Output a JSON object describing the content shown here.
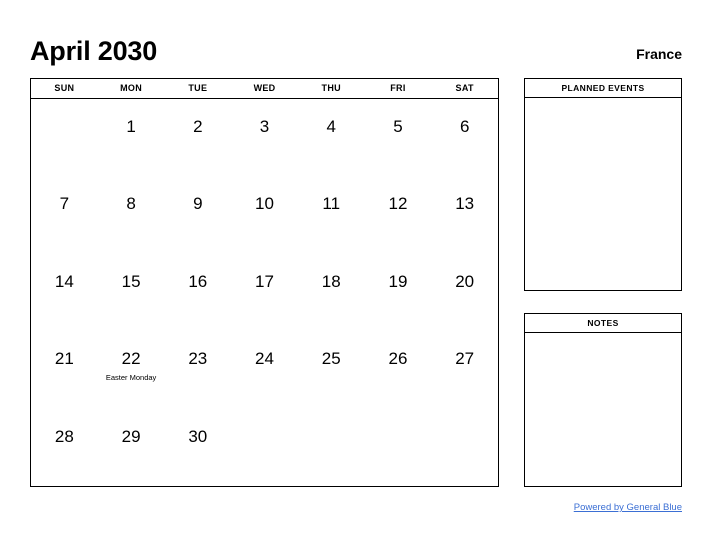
{
  "header": {
    "title": "April 2030",
    "region": "France"
  },
  "calendar": {
    "weekdays": [
      "SUN",
      "MON",
      "TUE",
      "WED",
      "THU",
      "FRI",
      "SAT"
    ],
    "weeks": [
      [
        {
          "day": ""
        },
        {
          "day": "1"
        },
        {
          "day": "2"
        },
        {
          "day": "3"
        },
        {
          "day": "4"
        },
        {
          "day": "5"
        },
        {
          "day": "6"
        }
      ],
      [
        {
          "day": "7"
        },
        {
          "day": "8"
        },
        {
          "day": "9"
        },
        {
          "day": "10"
        },
        {
          "day": "11"
        },
        {
          "day": "12"
        },
        {
          "day": "13"
        }
      ],
      [
        {
          "day": "14"
        },
        {
          "day": "15"
        },
        {
          "day": "16"
        },
        {
          "day": "17"
        },
        {
          "day": "18"
        },
        {
          "day": "19"
        },
        {
          "day": "20"
        }
      ],
      [
        {
          "day": "21"
        },
        {
          "day": "22",
          "event": "Easter Monday"
        },
        {
          "day": "23"
        },
        {
          "day": "24"
        },
        {
          "day": "25"
        },
        {
          "day": "26"
        },
        {
          "day": "27"
        }
      ],
      [
        {
          "day": "28"
        },
        {
          "day": "29"
        },
        {
          "day": "30"
        },
        {
          "day": ""
        },
        {
          "day": ""
        },
        {
          "day": ""
        },
        {
          "day": ""
        }
      ]
    ]
  },
  "panels": {
    "events": {
      "title": "PLANNED EVENTS",
      "content": ""
    },
    "notes": {
      "title": "NOTES",
      "content": ""
    }
  },
  "footer": {
    "link_text": "Powered by General Blue",
    "link_color": "#3b6fd4"
  }
}
